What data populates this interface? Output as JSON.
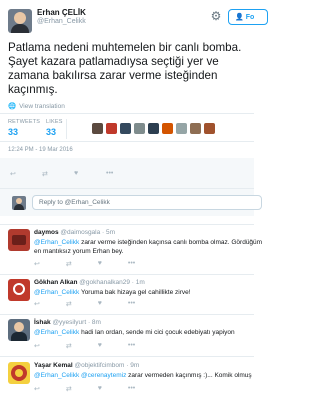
{
  "tweet": {
    "author_name": "Erhan ÇELİK",
    "author_handle": "@Erhan_Celikk",
    "follow_label": "Fo",
    "text": "Patlama nedeni muhtemelen bir canlı bomba.\nŞayet kazara patlamadıysa seçtiği yer ve\nzamana bakılırsa zarar verme isteğinden\nkaçınmış.",
    "view_translation": "View translation",
    "retweets_label": "RETWEETS",
    "retweets_value": "33",
    "likes_label": "LIKES",
    "likes_value": "33",
    "timestamp": "12:24 PM - 19 Mar 2016"
  },
  "reply_box": {
    "placeholder": "Reply to @Erhan_Celikk"
  },
  "replies": [
    {
      "name": "daymos",
      "handle": "@daimosgala",
      "time": "5m",
      "mention": "@Erhan_Celikk",
      "text": " zarar verme isteğinden kaçınsa canlı bomba olmaz. Gördüğüm",
      "text2": "en mantıksız yorum Erhan bey."
    },
    {
      "name": "Gökhan Alkan",
      "handle": "@gokhanalkan29",
      "time": "1m",
      "mention": "@Erhan_Celikk",
      "text": " Yoruma bak hizaya gel cahillikte zirve!",
      "text2": ""
    },
    {
      "name": "İshak",
      "handle": "@yyesilyurt",
      "time": "8m",
      "mention": "@Erhan_Celikk",
      "text": " hadi lan ordan, sende mi cici çocuk edebiyatı yapiyon",
      "text2": ""
    },
    {
      "name": "Yaşar Kemal",
      "handle": "@objektifcimbom",
      "time": "9m",
      "mention": "@Erhan_Celikk @cerenaytemiz",
      "text": " zarar vermeden kaçınmış :)... Komik olmuş",
      "text2": ""
    }
  ],
  "icons": {
    "gear": "gear-icon",
    "reply": "reply-icon",
    "retweet": "retweet-icon",
    "like": "heart-icon",
    "more": "more-icon"
  },
  "colors": {
    "accent": "#1da1f2",
    "muted": "#8899a6",
    "text": "#14171a"
  }
}
